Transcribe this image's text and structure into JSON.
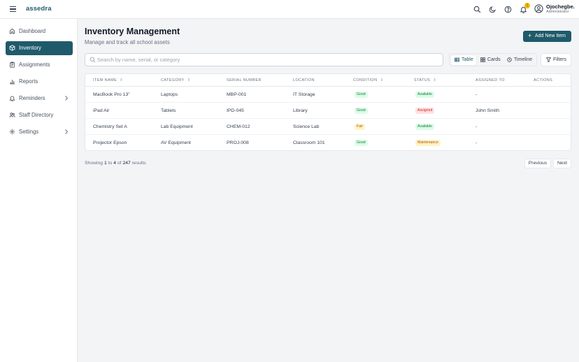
{
  "app": {
    "logo": "assedra"
  },
  "topbar": {
    "icons": [
      "search-icon",
      "moon-icon",
      "help-icon",
      "bell-icon"
    ],
    "notification_badge": "1",
    "user": {
      "name": "Ojochegbe.",
      "role": "Administrator"
    }
  },
  "sidebar": {
    "items": [
      {
        "label": "Dashboard",
        "icon": "home-icon",
        "active": false,
        "has_chevron": false
      },
      {
        "label": "Inventory",
        "icon": "box-icon",
        "active": true,
        "has_chevron": false
      },
      {
        "label": "Assignments",
        "icon": "clipboard-icon",
        "active": false,
        "has_chevron": false
      },
      {
        "label": "Reports",
        "icon": "bar-chart-icon",
        "active": false,
        "has_chevron": false
      },
      {
        "label": "Reminders",
        "icon": "bell-icon",
        "active": false,
        "has_chevron": true
      },
      {
        "label": "Staff Directory",
        "icon": "users-icon",
        "active": false,
        "has_chevron": false
      },
      {
        "label": "Settings",
        "icon": "gear-icon",
        "active": false,
        "has_chevron": true
      }
    ]
  },
  "header": {
    "title": "Inventory Management",
    "subtitle": "Manage and track all school assets",
    "add_button": "Add New Item"
  },
  "search": {
    "placeholder": "Search by name, serial, or category",
    "value": ""
  },
  "views": {
    "options": [
      "Table",
      "Cards",
      "Timeline"
    ],
    "selected": "Table"
  },
  "filters_label": "Filters",
  "table": {
    "columns": [
      "ITEM NAME",
      "CATEGORY",
      "SERIAL NUMBER",
      "LOCATION",
      "CONDITION",
      "STATUS",
      "ASSIGNED TO",
      "ACTIONS"
    ],
    "sortable": [
      true,
      true,
      false,
      false,
      true,
      true,
      false,
      false
    ],
    "rows": [
      {
        "name": "MacBook Pro 13\"",
        "category": "Laptops",
        "serial": "MBP-001",
        "location": "IT Storage",
        "condition": "Good",
        "status": "Available",
        "assigned": "-"
      },
      {
        "name": "iPad Air",
        "category": "Tablets",
        "serial": "IPD-045",
        "location": "Library",
        "condition": "Good",
        "status": "Assigned",
        "assigned": "John Smith"
      },
      {
        "name": "Chemistry Set A",
        "category": "Lab Equipment",
        "serial": "CHEM-012",
        "location": "Science Lab",
        "condition": "Fair",
        "status": "Available",
        "assigned": "-"
      },
      {
        "name": "Projector Epson",
        "category": "AV Equipment",
        "serial": "PROJ-008",
        "location": "Classroom 101",
        "condition": "Good",
        "status": "Maintenance",
        "assigned": "-"
      }
    ]
  },
  "pagination": {
    "prefix": "Showing",
    "from": "1",
    "to_word": "to",
    "to": "4",
    "of_word": "of",
    "total": "247",
    "suffix": "results",
    "previous": "Previous",
    "next": "Next"
  },
  "colors": {
    "accent": "#1f5a6b",
    "good_bg": "#dcfce7",
    "good_fg": "#15803d",
    "fair_bg": "#fef3c7",
    "fair_fg": "#b45309",
    "available_bg": "#dcfce7",
    "available_fg": "#15803d",
    "assigned_bg": "#fee2e2",
    "assigned_fg": "#dc2626",
    "maintenance_bg": "#fef3c7",
    "maintenance_fg": "#b45309"
  }
}
